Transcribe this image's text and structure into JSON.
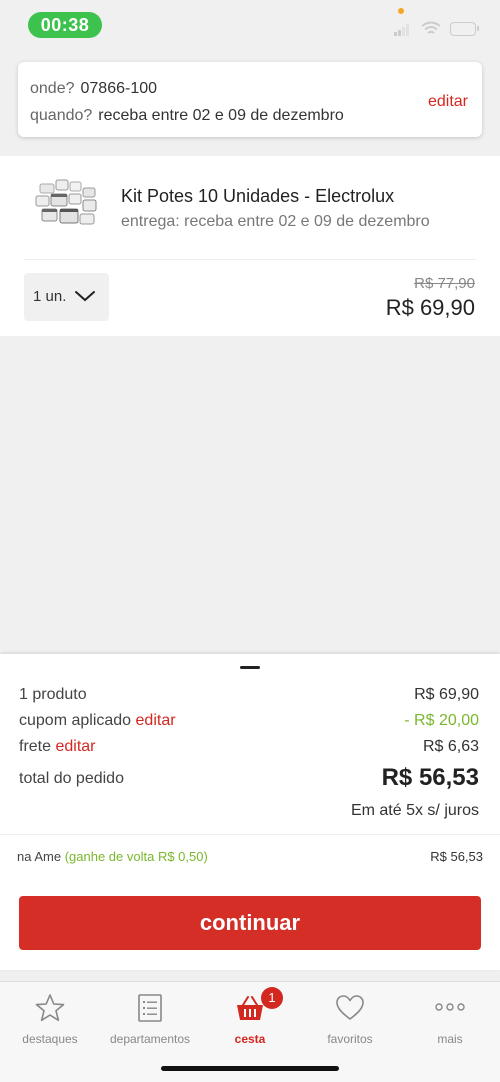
{
  "status_bar": {
    "time": "00:38"
  },
  "delivery": {
    "where_label": "onde?",
    "where_value": "07866-100",
    "when_label": "quando?",
    "when_value": "receba entre 02 e 09 de dezembro",
    "edit_label": "editar"
  },
  "product": {
    "title": "Kit Potes 10 Unidades - Electrolux",
    "delivery": "entrega: receba entre 02 e 09 de dezembro",
    "quantity": "1 un.",
    "price_old": "R$ 77,90",
    "price_new": "R$ 69,90"
  },
  "summary": {
    "products_label": "1 produto",
    "products_value": "R$ 69,90",
    "coupon_label": "cupom aplicado",
    "coupon_edit": "editar",
    "coupon_value": "- R$ 20,00",
    "shipping_label": "frete",
    "shipping_edit": "editar",
    "shipping_value": "R$ 6,63",
    "total_label": "total do pedido",
    "total_value": "R$ 56,53",
    "installments": "Em até 5x s/ juros",
    "ame_label": "na Ame",
    "ame_cashback": "(ganhe de volta R$ 0,50)",
    "ame_value": "R$ 56,53",
    "continue_label": "continuar"
  },
  "tabs": [
    {
      "label": "destaques",
      "icon": "star-icon"
    },
    {
      "label": "departamentos",
      "icon": "list-icon"
    },
    {
      "label": "cesta",
      "icon": "basket-icon",
      "badge": "1",
      "active": true
    },
    {
      "label": "favoritos",
      "icon": "heart-icon"
    },
    {
      "label": "mais",
      "icon": "more-icon"
    }
  ],
  "colors": {
    "accent": "#d3281f",
    "green": "#7bb72d",
    "status_green": "#3cc24d"
  }
}
